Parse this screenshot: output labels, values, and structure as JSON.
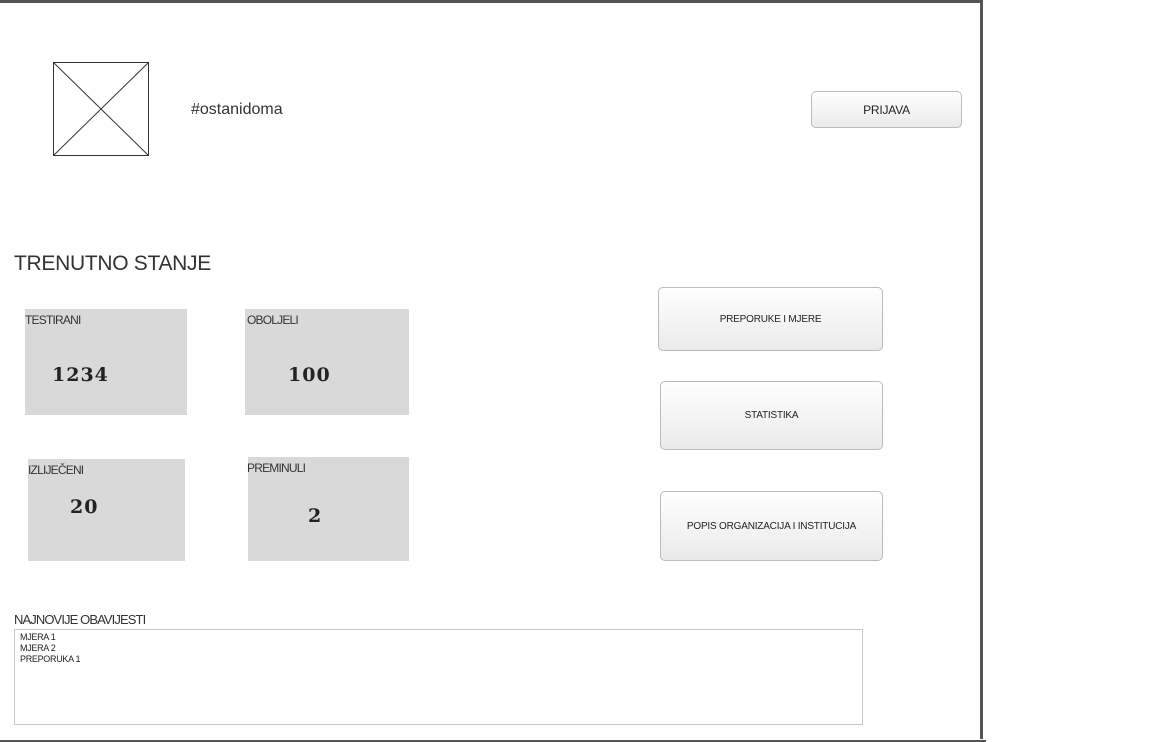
{
  "header": {
    "logo_icon": "image-placeholder-icon",
    "tagline": "#ostanidoma",
    "login_label": "PRIJAVA"
  },
  "status": {
    "title": "TRENUTNO STANJE",
    "cards": [
      {
        "label": "TESTIRANI",
        "value": "1234"
      },
      {
        "label": "OBOLJELI",
        "value": "100"
      },
      {
        "label": "IZLIJEČENI",
        "value": "20"
      },
      {
        "label": "PREMINULI",
        "value": "2"
      }
    ]
  },
  "nav": {
    "recommendations": "PREPORUKE I MJERE",
    "statistics": "STATISTIKA",
    "organizations": "POPIS ORGANIZACIJA I INSTITUCIJA"
  },
  "news": {
    "title": "NAJNOVIJE OBAVIJESTI",
    "items": [
      "MJERA 1",
      "MJERA 2",
      "PREPORUKA 1"
    ]
  }
}
